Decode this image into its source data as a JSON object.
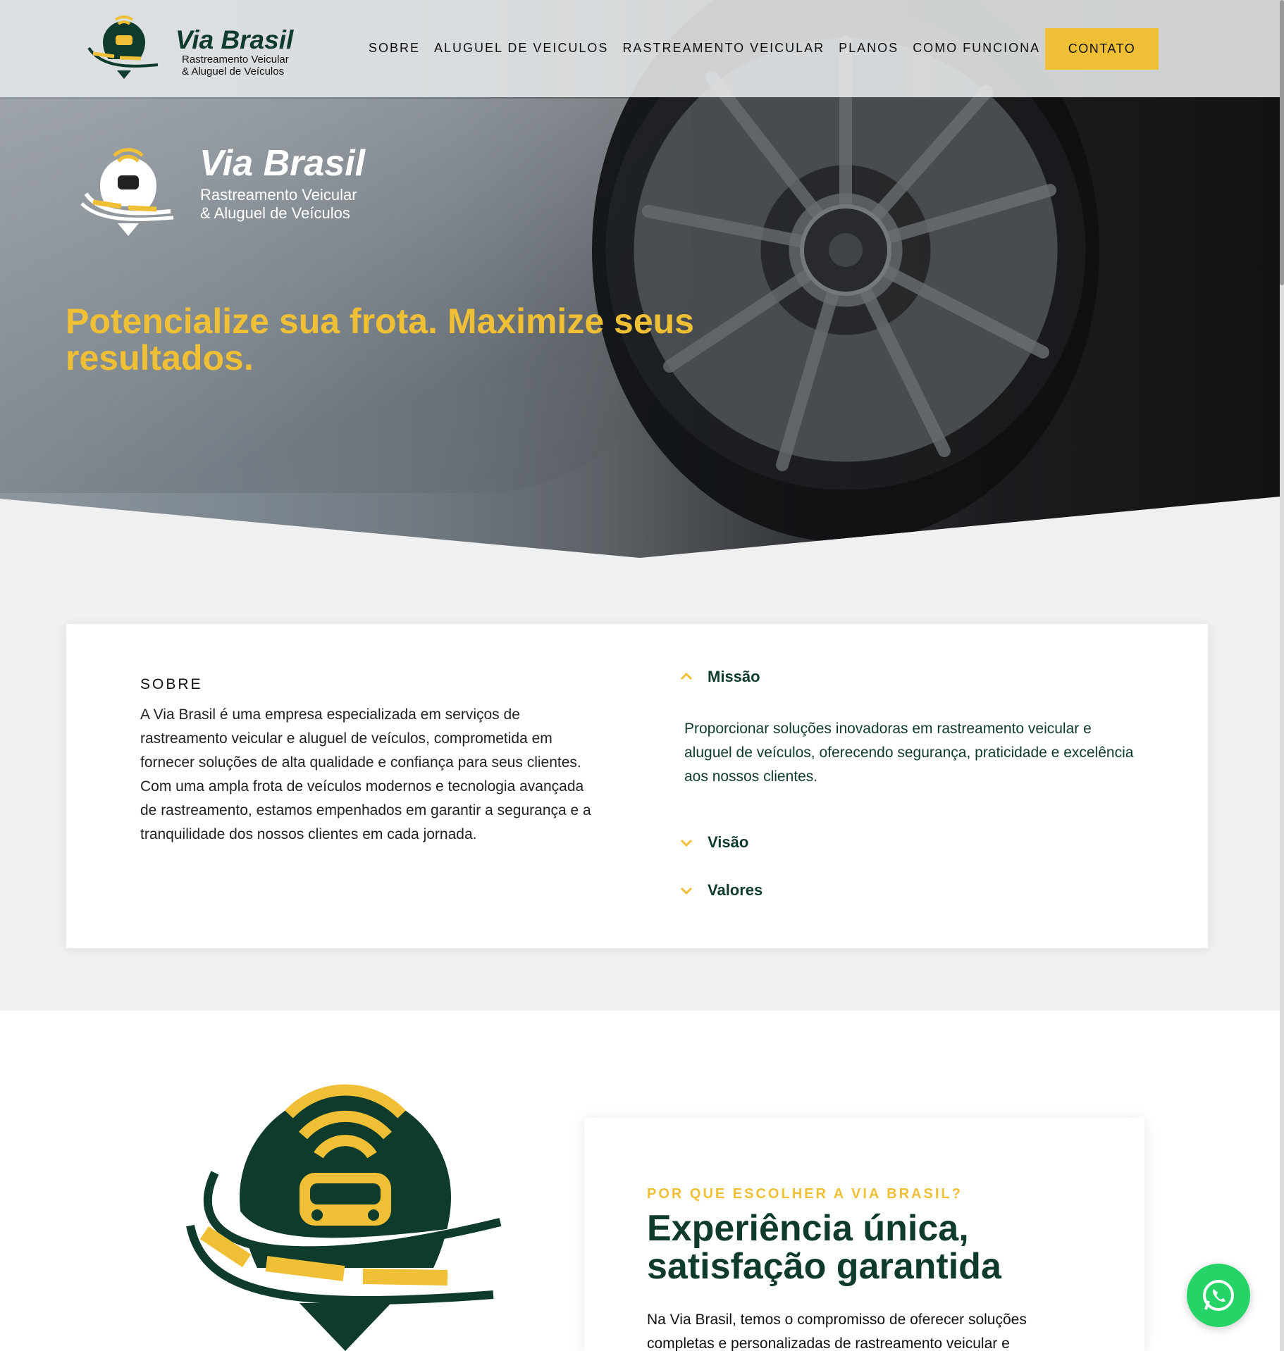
{
  "brand": {
    "name": "Via Brasil",
    "tagline_line1": "Rastreamento Veicular",
    "tagline_line2": "& Aluguel de Veículos",
    "colors": {
      "green": "#0e3b2c",
      "yellow": "#efbf36",
      "whatsapp": "#25d366"
    }
  },
  "nav": {
    "items": [
      {
        "label": "SOBRE"
      },
      {
        "label": "ALUGUEL DE VEICULOS"
      },
      {
        "label": "RASTREAMENTO VEICULAR"
      },
      {
        "label": "PLANOS"
      },
      {
        "label": "COMO FUNCIONA"
      }
    ],
    "cta_label": "CONTATO"
  },
  "hero": {
    "headline": "Potencialize sua frota. Maximize seus resultados."
  },
  "about": {
    "label": "SOBRE",
    "text": "A Via Brasil é uma empresa especializada em serviços de rastreamento veicular e aluguel de veículos, comprometida em fornecer soluções de alta qualidade e confiança para seus clientes. Com uma ampla frota de veículos modernos e tecnologia avançada de rastreamento, estamos empenhados em garantir a segurança e a tranquilidade dos nossos clientes em cada jornada.",
    "accordion": [
      {
        "title": "Missão",
        "expanded": true,
        "icon": "chevron-up-icon",
        "body": "Proporcionar soluções inovadoras em rastreamento veicular e aluguel de veículos, oferecendo segurança, praticidade e excelência aos nossos clientes."
      },
      {
        "title": "Visão",
        "expanded": false,
        "icon": "chevron-down-icon"
      },
      {
        "title": "Valores",
        "expanded": false,
        "icon": "chevron-down-icon"
      }
    ]
  },
  "why": {
    "label": "POR QUE ESCOLHER A VIA BRASIL?",
    "title": "Experiência única, satisfação garantida",
    "text": "Na Via Brasil, temos o compromisso de oferecer soluções completas e personalizadas de rastreamento veicular e"
  },
  "whatsapp": {
    "icon": "whatsapp-icon"
  }
}
